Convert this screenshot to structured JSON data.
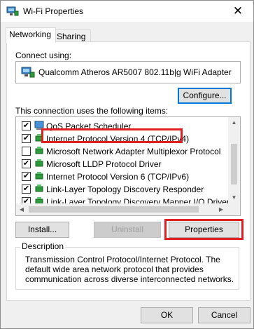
{
  "window": {
    "title": "Wi-Fi Properties",
    "close_glyph": "✕",
    "title_icon": "network-adapter-icon"
  },
  "tabs": [
    {
      "label": "Networking",
      "active": true
    },
    {
      "label": "Sharing",
      "active": false
    }
  ],
  "connect": {
    "label": "Connect using:",
    "adapter_name": "Qualcomm Atheros AR5007 802.11b|g WiFi Adapter",
    "adapter_icon": "network-adapter-icon",
    "configure_label": "Configure..."
  },
  "items": {
    "label": "This connection uses the following items:",
    "list": [
      {
        "label": "QoS Packet Scheduler",
        "checked": true,
        "icon": "scheduler-icon"
      },
      {
        "label": "Internet Protocol Version 4 (TCP/IPv4)",
        "checked": true,
        "icon": "protocol-icon",
        "selected": true
      },
      {
        "label": "Microsoft Network Adapter Multiplexor Protocol",
        "checked": false,
        "icon": "protocol-icon"
      },
      {
        "label": "Microsoft LLDP Protocol Driver",
        "checked": true,
        "icon": "protocol-icon"
      },
      {
        "label": "Internet Protocol Version 6 (TCP/IPv6)",
        "checked": true,
        "icon": "protocol-icon"
      },
      {
        "label": "Link-Layer Topology Discovery Responder",
        "checked": true,
        "icon": "protocol-icon"
      },
      {
        "label": "Link-Layer Topology Discovery Mapper I/O Driver",
        "checked": true,
        "icon": "protocol-icon"
      }
    ]
  },
  "actions": {
    "install_label": "Install...",
    "uninstall_label": "Uninstall",
    "properties_label": "Properties"
  },
  "description": {
    "title": "Description",
    "text": "Transmission Control Protocol/Internet Protocol. The default wide area network protocol that provides communication across diverse interconnected networks."
  },
  "footer": {
    "ok_label": "OK",
    "cancel_label": "Cancel"
  },
  "colors": {
    "highlight": "#e02020",
    "focus": "#0078d7",
    "window_bg": "#f0f0f0"
  }
}
